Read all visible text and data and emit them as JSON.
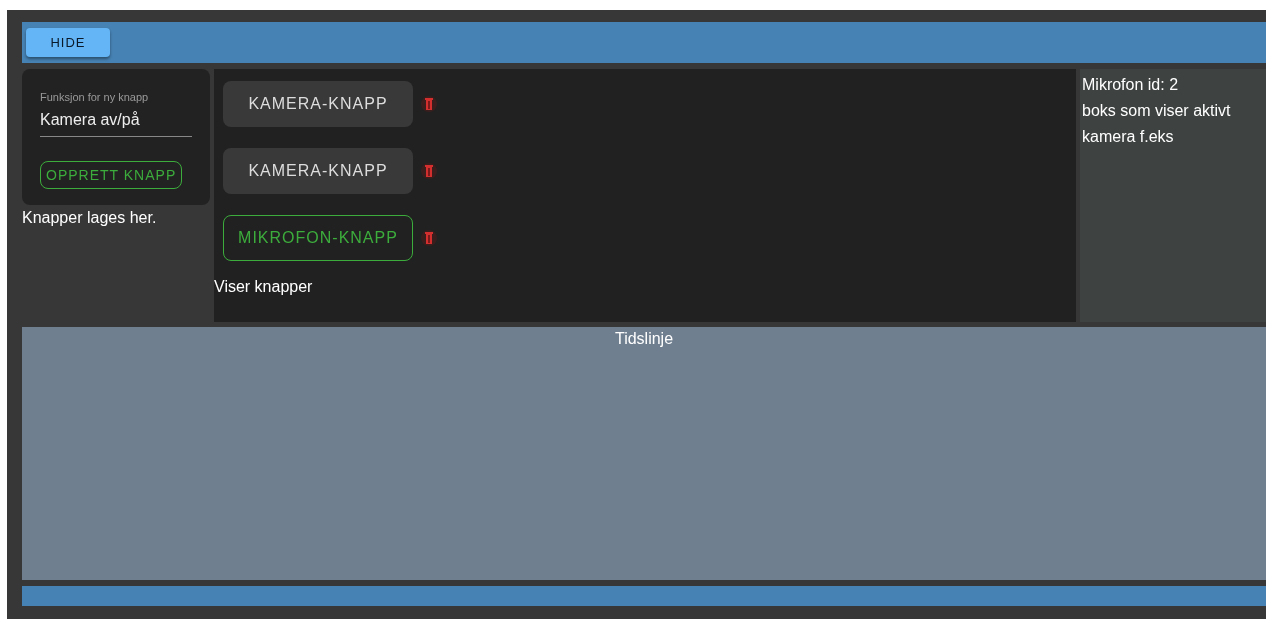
{
  "top_bar": {
    "hide_button": "HIDE"
  },
  "creator": {
    "field_label": "Funksjon for ny knapp",
    "field_value": "Kamera av/på",
    "create_button": "OPPRETT KNAPP",
    "caption": "Knapper lages her."
  },
  "buttons": [
    {
      "label": "KAMERA-KNAPP",
      "kind": "filled"
    },
    {
      "label": "KAMERA-KNAPP",
      "kind": "filled"
    },
    {
      "label": "MIKROFON-KNAPP",
      "kind": "outlined"
    }
  ],
  "buttons_caption": "Viser knapper",
  "info_lines": [
    "Mikrofon id: 2",
    "boks som viser aktivt",
    "kamera f.eks"
  ],
  "timeline": {
    "title": "Tidslinje"
  }
}
